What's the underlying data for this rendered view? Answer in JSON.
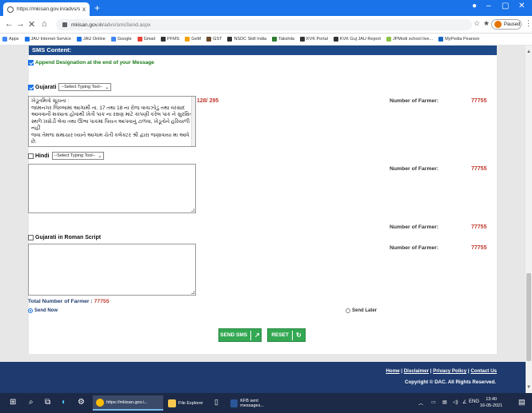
{
  "browser": {
    "tab_title": "https://mkisan.gov.in/advs/smsS",
    "tab_close": "x",
    "new_tab": "+",
    "url_domain": "mkisan.gov.in",
    "url_path": "/advs/smsSend.aspx",
    "profile_label": "Paused",
    "bookmarks": [
      {
        "label": "Apps",
        "color": "#4285f4"
      },
      {
        "label": "JAU Internet Service",
        "color": "#1a73e8"
      },
      {
        "label": "JAU Online",
        "color": "#1a73e8"
      },
      {
        "label": "Google",
        "color": "#4285f4"
      },
      {
        "label": "Gmail",
        "color": "#ea4335"
      },
      {
        "label": "PFMS",
        "color": "#333333"
      },
      {
        "label": "GeM",
        "color": "#f4a300"
      },
      {
        "label": "GST",
        "color": "#6b4c2a"
      },
      {
        "label": "NSDC Skill India",
        "color": "#333333"
      },
      {
        "label": "Takshila",
        "color": "#2e7d32"
      },
      {
        "label": "KVK Portal",
        "color": "#333333"
      },
      {
        "label": "KVK Guj JAU Report",
        "color": "#333333"
      },
      {
        "label": "JPModi school live...",
        "color": "#8bc34a"
      },
      {
        "label": "MyPedia Pearson",
        "color": "#1565c0"
      }
    ]
  },
  "sms": {
    "header": "SMS Content:",
    "append_designation_label": "Append Designation at the end of your Message",
    "gujarati_label": "Gujarati",
    "typing_tool_placeholder": "--Select Typing Tool--",
    "gujarati_message": "ખેડૂતમિત્રો સૂચના :\nજામનગર જિલ્લામાં આગામી તા. 17 તથા 18 ના રોજ વાવાઝોડું તથા વરસાદ\nઆવવાની શક્યતા હોવાથી ખેતી પાક ના રક્ષણ માટે કાપણી કરેલ પાક ને સુરક્ષિત\nસ્થળે ખસેડી લેવા તથા ઊભા પાકમાં પિયત આપવાનું ટાળવા, ખેડૂતોને હરિયાળી નહીં\nજવા તેમજ સમાચાર ધ્યાને આગામ ચેતી કલેક્ટર શ્રી દ્વારા જણાવાયા મા આવે છે.",
    "gujarati_counter": "128/ 295",
    "hindi_label": "Hindi",
    "roman_label": "Gujarati in Roman Script",
    "farmer_label": "Number of Farmer:",
    "farmer_count": "77755",
    "total_label": "Total Number of Farmer :",
    "total_count": "77755",
    "send_now_label": "Send Now",
    "send_later_label": "Send Later",
    "send_button": "SEND SMS",
    "reset_button": "RESET"
  },
  "footer": {
    "home": "Home",
    "sep": " | ",
    "disclaimer": "Disclaimer",
    "privacy": "Privacy Policy",
    "contact": "Contact Us",
    "copyright": "Copyright © DAC. All Rights Reserved."
  },
  "taskbar": {
    "apps": [
      {
        "label": "https://mkisan.gov.i...",
        "active": true
      },
      {
        "label": "File Explorer",
        "active": false
      },
      {
        "label": "KFB sent messages...",
        "active": false
      }
    ],
    "lang": "ENG",
    "time": "13:40",
    "date": "16-05-2021"
  }
}
